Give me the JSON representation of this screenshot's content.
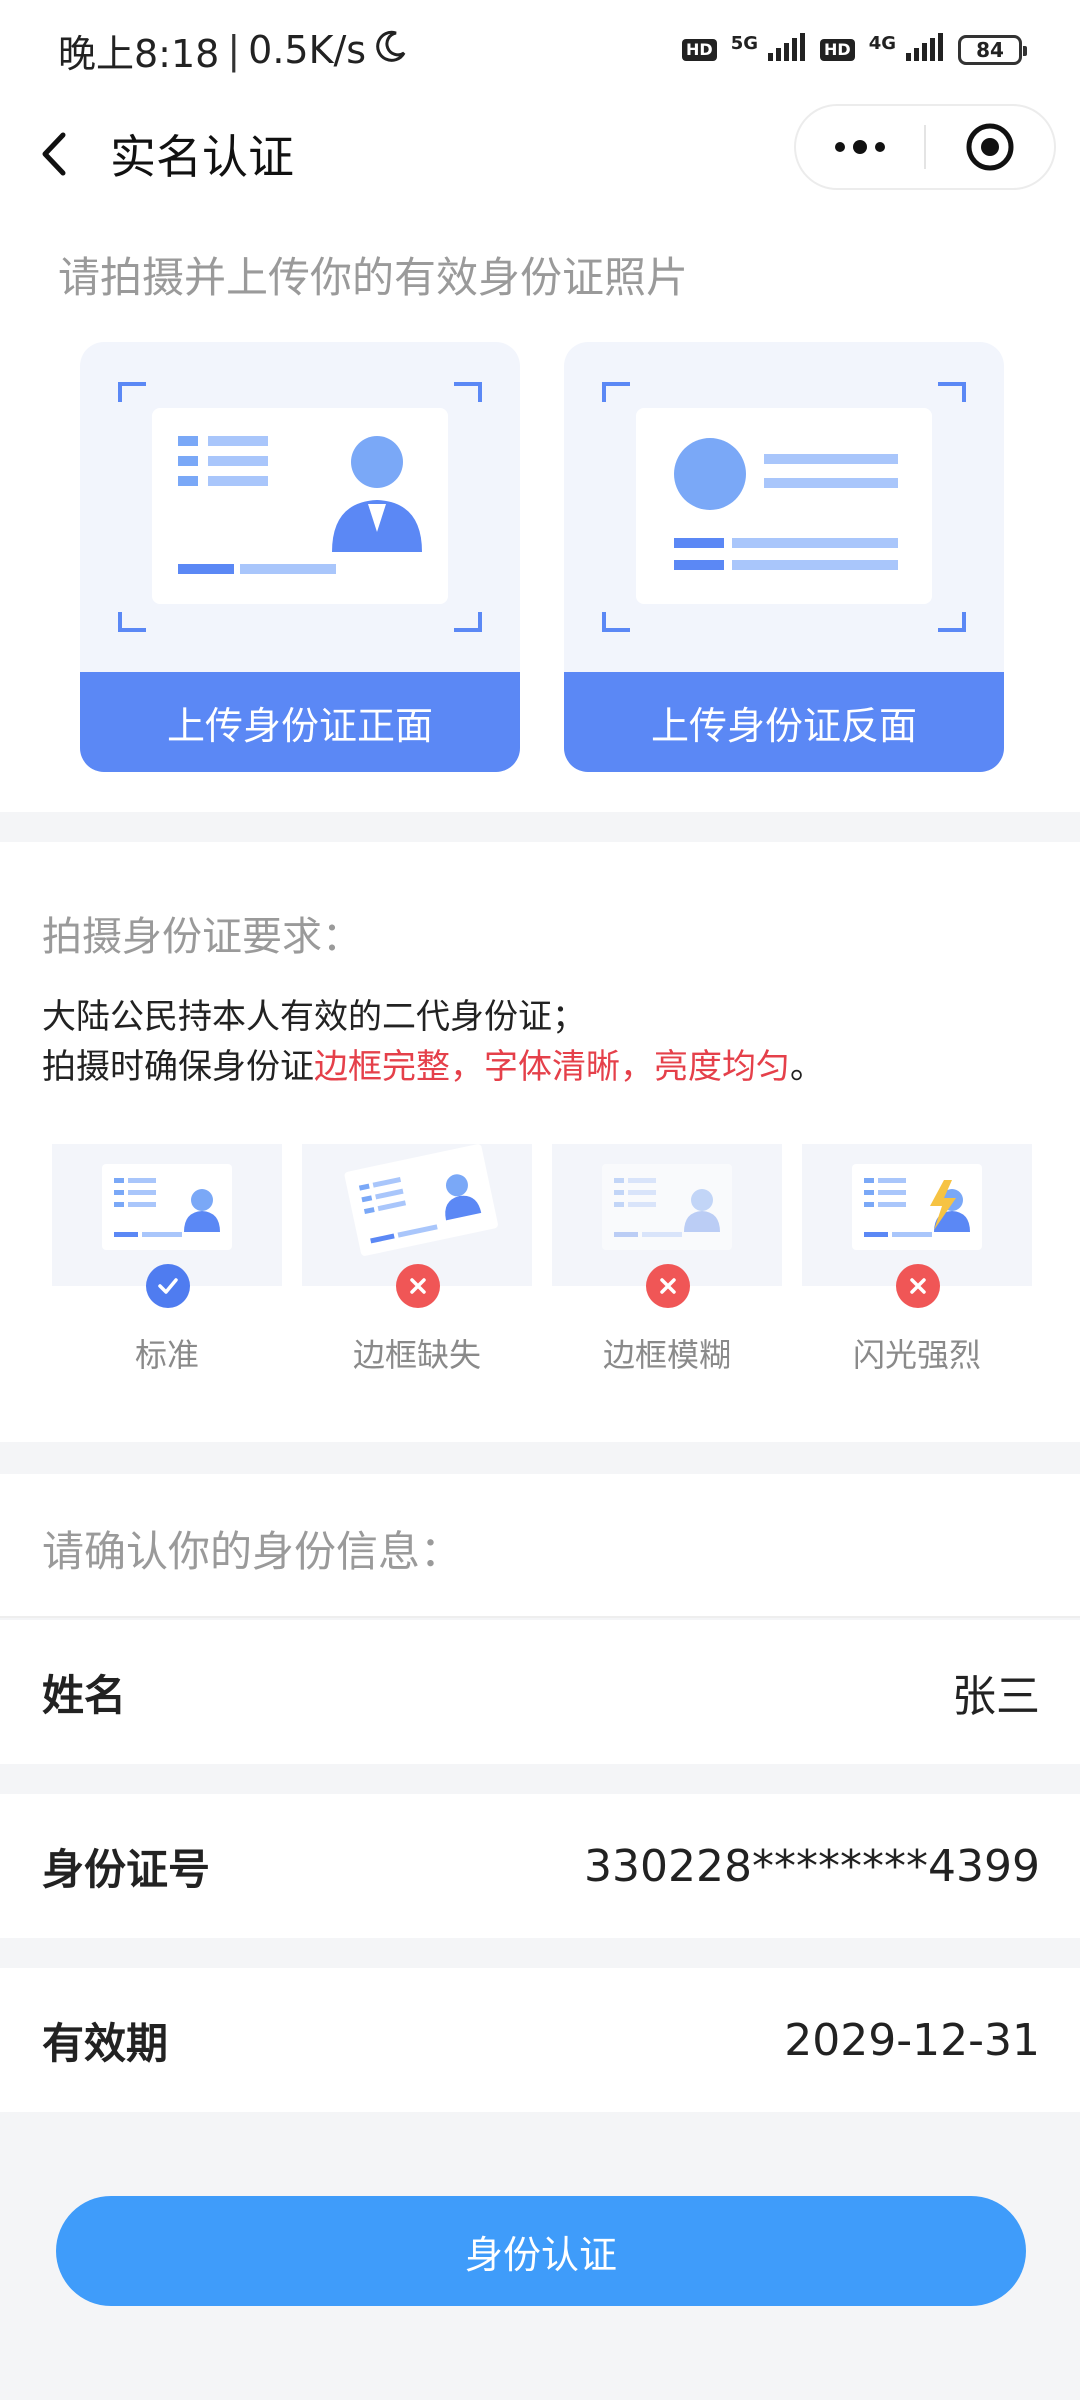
{
  "status_bar": {
    "time": "晚上8:18",
    "speed": "0.5K/s",
    "hd1": "HD",
    "net1": "5G",
    "hd2": "HD",
    "net2": "4G",
    "battery": "84"
  },
  "nav": {
    "title": "实名认证"
  },
  "upload": {
    "title": "请拍摄并上传你的有效身份证照片",
    "front_label": "上传身份证正面",
    "back_label": "上传身份证反面"
  },
  "requirements": {
    "title": "拍摄身份证要求：",
    "line1": "大陆公民持本人有效的二代身份证；",
    "line2_prefix": "拍摄时确保身份证",
    "line2_highlight": "边框完整，字体清晰，亮度均匀",
    "line2_suffix": "。",
    "samples": [
      {
        "label": "标准",
        "status": "ok"
      },
      {
        "label": "边框缺失",
        "status": "bad"
      },
      {
        "label": "边框模糊",
        "status": "bad"
      },
      {
        "label": "闪光强烈",
        "status": "bad"
      }
    ]
  },
  "confirm": {
    "title": "请确认你的身份信息：",
    "name_label": "姓名",
    "name_value": "张三",
    "id_label": "身份证号",
    "id_value": "330228********4399",
    "expiry_label": "有效期",
    "expiry_value": "2029-12-31"
  },
  "submit": {
    "label": "身份认证"
  },
  "colors": {
    "upload_button": "#5b88f5",
    "submit_button": "#3f9cfa",
    "highlight_text": "#e5404a",
    "ok_mark": "#4f7cf0",
    "bad_mark": "#f05656"
  }
}
